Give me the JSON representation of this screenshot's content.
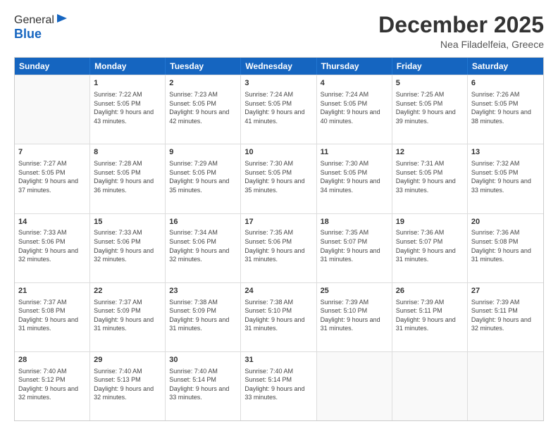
{
  "logo": {
    "general": "General",
    "blue": "Blue"
  },
  "header": {
    "month": "December 2025",
    "location": "Nea Filadelfeia, Greece"
  },
  "weekdays": [
    "Sunday",
    "Monday",
    "Tuesday",
    "Wednesday",
    "Thursday",
    "Friday",
    "Saturday"
  ],
  "weeks": [
    [
      {
        "day": "",
        "sunrise": "",
        "sunset": "",
        "daylight": ""
      },
      {
        "day": "1",
        "sunrise": "Sunrise: 7:22 AM",
        "sunset": "Sunset: 5:05 PM",
        "daylight": "Daylight: 9 hours and 43 minutes."
      },
      {
        "day": "2",
        "sunrise": "Sunrise: 7:23 AM",
        "sunset": "Sunset: 5:05 PM",
        "daylight": "Daylight: 9 hours and 42 minutes."
      },
      {
        "day": "3",
        "sunrise": "Sunrise: 7:24 AM",
        "sunset": "Sunset: 5:05 PM",
        "daylight": "Daylight: 9 hours and 41 minutes."
      },
      {
        "day": "4",
        "sunrise": "Sunrise: 7:24 AM",
        "sunset": "Sunset: 5:05 PM",
        "daylight": "Daylight: 9 hours and 40 minutes."
      },
      {
        "day": "5",
        "sunrise": "Sunrise: 7:25 AM",
        "sunset": "Sunset: 5:05 PM",
        "daylight": "Daylight: 9 hours and 39 minutes."
      },
      {
        "day": "6",
        "sunrise": "Sunrise: 7:26 AM",
        "sunset": "Sunset: 5:05 PM",
        "daylight": "Daylight: 9 hours and 38 minutes."
      }
    ],
    [
      {
        "day": "7",
        "sunrise": "Sunrise: 7:27 AM",
        "sunset": "Sunset: 5:05 PM",
        "daylight": "Daylight: 9 hours and 37 minutes."
      },
      {
        "day": "8",
        "sunrise": "Sunrise: 7:28 AM",
        "sunset": "Sunset: 5:05 PM",
        "daylight": "Daylight: 9 hours and 36 minutes."
      },
      {
        "day": "9",
        "sunrise": "Sunrise: 7:29 AM",
        "sunset": "Sunset: 5:05 PM",
        "daylight": "Daylight: 9 hours and 35 minutes."
      },
      {
        "day": "10",
        "sunrise": "Sunrise: 7:30 AM",
        "sunset": "Sunset: 5:05 PM",
        "daylight": "Daylight: 9 hours and 35 minutes."
      },
      {
        "day": "11",
        "sunrise": "Sunrise: 7:30 AM",
        "sunset": "Sunset: 5:05 PM",
        "daylight": "Daylight: 9 hours and 34 minutes."
      },
      {
        "day": "12",
        "sunrise": "Sunrise: 7:31 AM",
        "sunset": "Sunset: 5:05 PM",
        "daylight": "Daylight: 9 hours and 33 minutes."
      },
      {
        "day": "13",
        "sunrise": "Sunrise: 7:32 AM",
        "sunset": "Sunset: 5:05 PM",
        "daylight": "Daylight: 9 hours and 33 minutes."
      }
    ],
    [
      {
        "day": "14",
        "sunrise": "Sunrise: 7:33 AM",
        "sunset": "Sunset: 5:06 PM",
        "daylight": "Daylight: 9 hours and 32 minutes."
      },
      {
        "day": "15",
        "sunrise": "Sunrise: 7:33 AM",
        "sunset": "Sunset: 5:06 PM",
        "daylight": "Daylight: 9 hours and 32 minutes."
      },
      {
        "day": "16",
        "sunrise": "Sunrise: 7:34 AM",
        "sunset": "Sunset: 5:06 PM",
        "daylight": "Daylight: 9 hours and 32 minutes."
      },
      {
        "day": "17",
        "sunrise": "Sunrise: 7:35 AM",
        "sunset": "Sunset: 5:06 PM",
        "daylight": "Daylight: 9 hours and 31 minutes."
      },
      {
        "day": "18",
        "sunrise": "Sunrise: 7:35 AM",
        "sunset": "Sunset: 5:07 PM",
        "daylight": "Daylight: 9 hours and 31 minutes."
      },
      {
        "day": "19",
        "sunrise": "Sunrise: 7:36 AM",
        "sunset": "Sunset: 5:07 PM",
        "daylight": "Daylight: 9 hours and 31 minutes."
      },
      {
        "day": "20",
        "sunrise": "Sunrise: 7:36 AM",
        "sunset": "Sunset: 5:08 PM",
        "daylight": "Daylight: 9 hours and 31 minutes."
      }
    ],
    [
      {
        "day": "21",
        "sunrise": "Sunrise: 7:37 AM",
        "sunset": "Sunset: 5:08 PM",
        "daylight": "Daylight: 9 hours and 31 minutes."
      },
      {
        "day": "22",
        "sunrise": "Sunrise: 7:37 AM",
        "sunset": "Sunset: 5:09 PM",
        "daylight": "Daylight: 9 hours and 31 minutes."
      },
      {
        "day": "23",
        "sunrise": "Sunrise: 7:38 AM",
        "sunset": "Sunset: 5:09 PM",
        "daylight": "Daylight: 9 hours and 31 minutes."
      },
      {
        "day": "24",
        "sunrise": "Sunrise: 7:38 AM",
        "sunset": "Sunset: 5:10 PM",
        "daylight": "Daylight: 9 hours and 31 minutes."
      },
      {
        "day": "25",
        "sunrise": "Sunrise: 7:39 AM",
        "sunset": "Sunset: 5:10 PM",
        "daylight": "Daylight: 9 hours and 31 minutes."
      },
      {
        "day": "26",
        "sunrise": "Sunrise: 7:39 AM",
        "sunset": "Sunset: 5:11 PM",
        "daylight": "Daylight: 9 hours and 31 minutes."
      },
      {
        "day": "27",
        "sunrise": "Sunrise: 7:39 AM",
        "sunset": "Sunset: 5:11 PM",
        "daylight": "Daylight: 9 hours and 32 minutes."
      }
    ],
    [
      {
        "day": "28",
        "sunrise": "Sunrise: 7:40 AM",
        "sunset": "Sunset: 5:12 PM",
        "daylight": "Daylight: 9 hours and 32 minutes."
      },
      {
        "day": "29",
        "sunrise": "Sunrise: 7:40 AM",
        "sunset": "Sunset: 5:13 PM",
        "daylight": "Daylight: 9 hours and 32 minutes."
      },
      {
        "day": "30",
        "sunrise": "Sunrise: 7:40 AM",
        "sunset": "Sunset: 5:14 PM",
        "daylight": "Daylight: 9 hours and 33 minutes."
      },
      {
        "day": "31",
        "sunrise": "Sunrise: 7:40 AM",
        "sunset": "Sunset: 5:14 PM",
        "daylight": "Daylight: 9 hours and 33 minutes."
      },
      {
        "day": "",
        "sunrise": "",
        "sunset": "",
        "daylight": ""
      },
      {
        "day": "",
        "sunrise": "",
        "sunset": "",
        "daylight": ""
      },
      {
        "day": "",
        "sunrise": "",
        "sunset": "",
        "daylight": ""
      }
    ]
  ]
}
